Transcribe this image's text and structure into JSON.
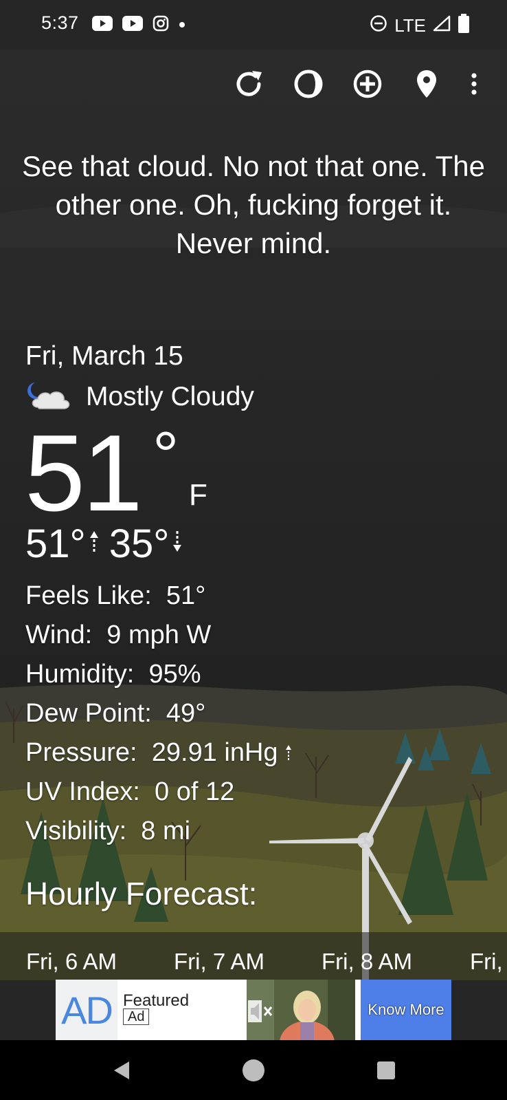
{
  "status_bar": {
    "time": "5:37",
    "left_icons": [
      "youtube-icon",
      "youtube-icon",
      "instagram-icon",
      "dot-icon"
    ],
    "network": "LTE",
    "right_icons": [
      "do-not-disturb-icon",
      "signal-icon",
      "battery-icon"
    ]
  },
  "toolbar": {
    "icons": [
      "refresh-icon",
      "theme-icon",
      "add-location-icon",
      "location-pin-icon",
      "overflow-menu-icon"
    ]
  },
  "quote": "See that cloud. No not that one. The other one. Oh, fucking forget it. Never mind.",
  "current": {
    "date": "Fri, March 15",
    "condition_icon": "partly-cloudy-night-icon",
    "condition": "Mostly Cloudy",
    "temperature": "51",
    "degree": "°",
    "unit": "F",
    "high": "51°",
    "low": "35°"
  },
  "details": [
    {
      "label": "Feels Like:",
      "value": "51°"
    },
    {
      "label": "Wind:",
      "value": "9 mph W"
    },
    {
      "label": "Humidity:",
      "value": "95%"
    },
    {
      "label": "Dew Point:",
      "value": "49°"
    },
    {
      "label": "Pressure:",
      "value": "29.91 inHg",
      "trend_icon": "up-arrow-icon"
    },
    {
      "label": "UV Index:",
      "value": "0 of 12"
    },
    {
      "label": "Visibility:",
      "value": "8 mi"
    }
  ],
  "hourly": {
    "title": "Hourly Forecast:",
    "hours": [
      "Fri, 6 AM",
      "Fri, 7 AM",
      "Fri, 8 AM",
      "Fri,"
    ]
  },
  "ad": {
    "logo": "AD",
    "featured": "Featured",
    "badge": "Ad",
    "mute_icon": "muted-speaker-icon",
    "cta": "Know More"
  },
  "nav": {
    "icons": [
      "back-icon",
      "home-icon",
      "recents-icon"
    ]
  }
}
